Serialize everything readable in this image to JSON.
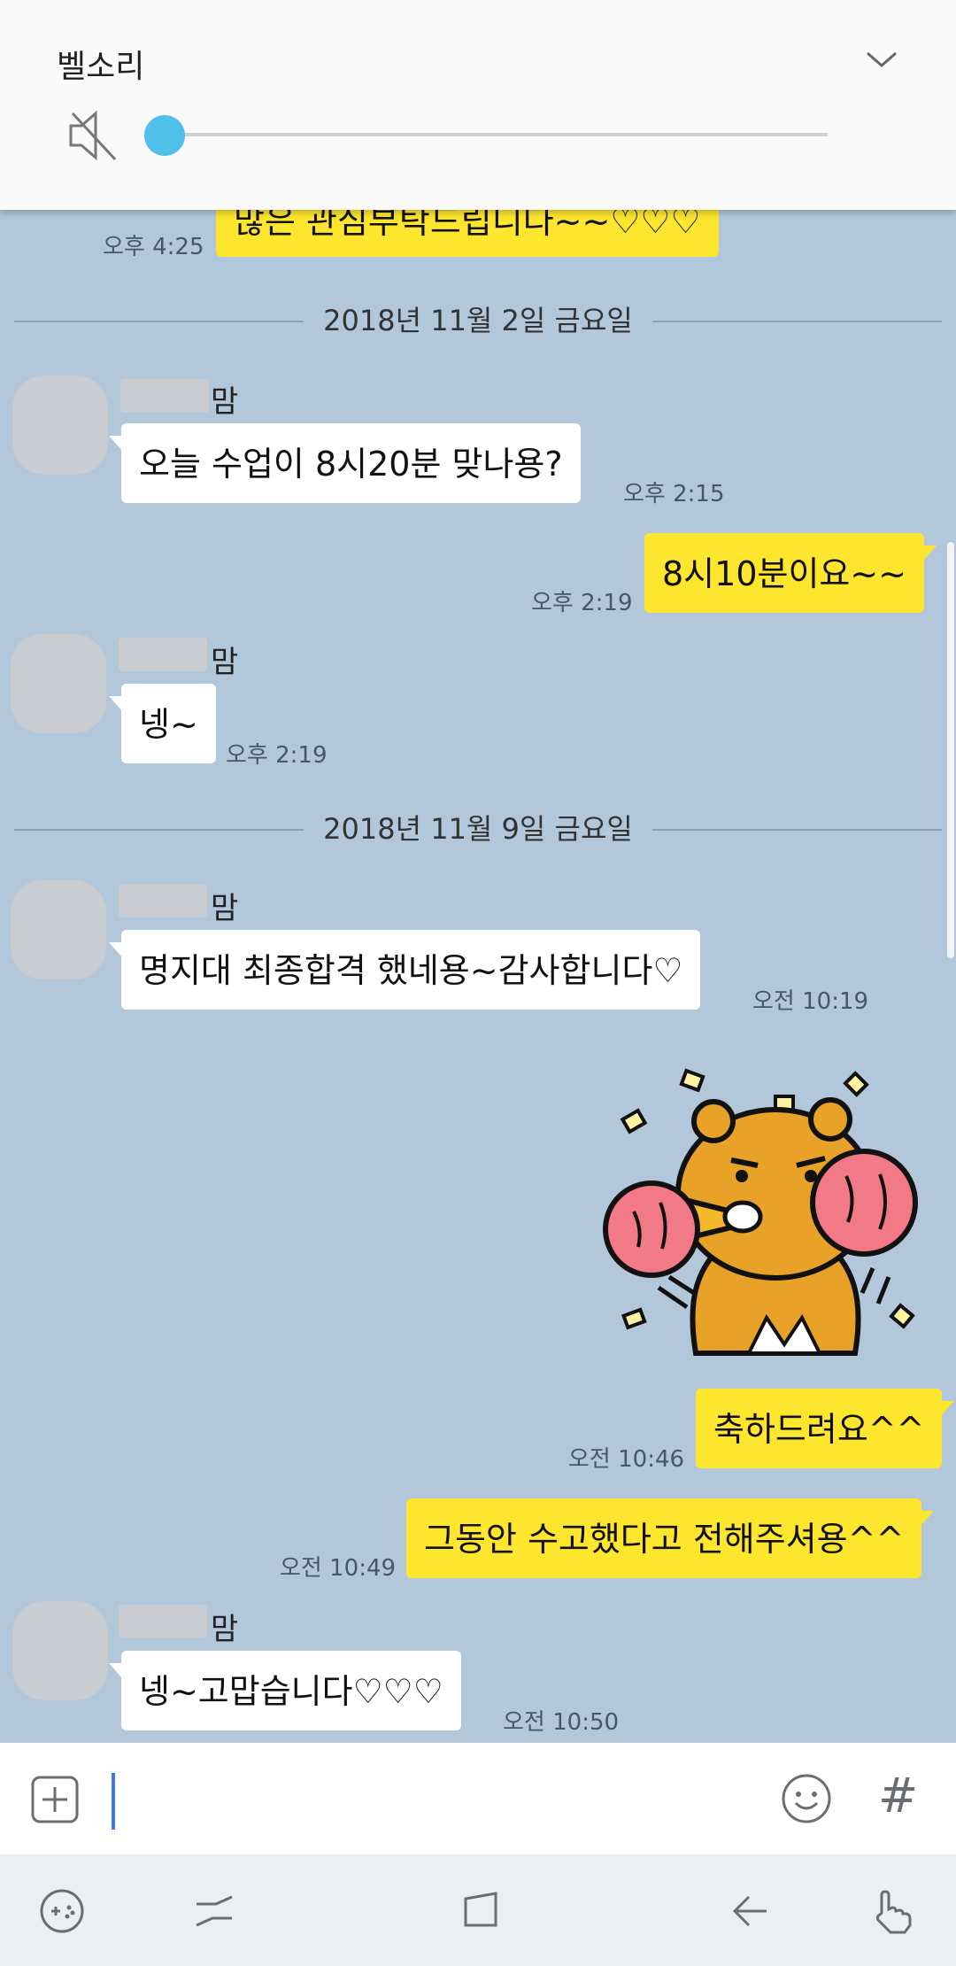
{
  "volume": {
    "title": "벨소리",
    "level": 0
  },
  "chat": {
    "clipped_message": {
      "text": "많은 관심부탁드립니다~~♡♡♡",
      "time": "오후 4:25"
    },
    "dates": [
      "2018년 11월 2일 금요일",
      "2018년 11월 9일 금요일"
    ],
    "sender_suffix": "맘",
    "messages": [
      {
        "text": "오늘  수업이 8시20분 맞나용?",
        "time": "오후 2:15"
      },
      {
        "text": "8시10분이요~~",
        "time": "오후 2:19"
      },
      {
        "text": "넹~",
        "time": "오후 2:19"
      },
      {
        "text": "명지대 최종합격 했네용~감사합니다♡",
        "time": "오전 10:19"
      },
      {
        "text": "축하드려요^^",
        "time": "오전 10:46"
      },
      {
        "text": "그동안 수고했다고 전해주셔용^^",
        "time": "오전 10:49"
      },
      {
        "text": "넹~고맙습니다♡♡♡",
        "time": "오전 10:50"
      }
    ]
  },
  "input": {
    "hash_label": "#"
  }
}
